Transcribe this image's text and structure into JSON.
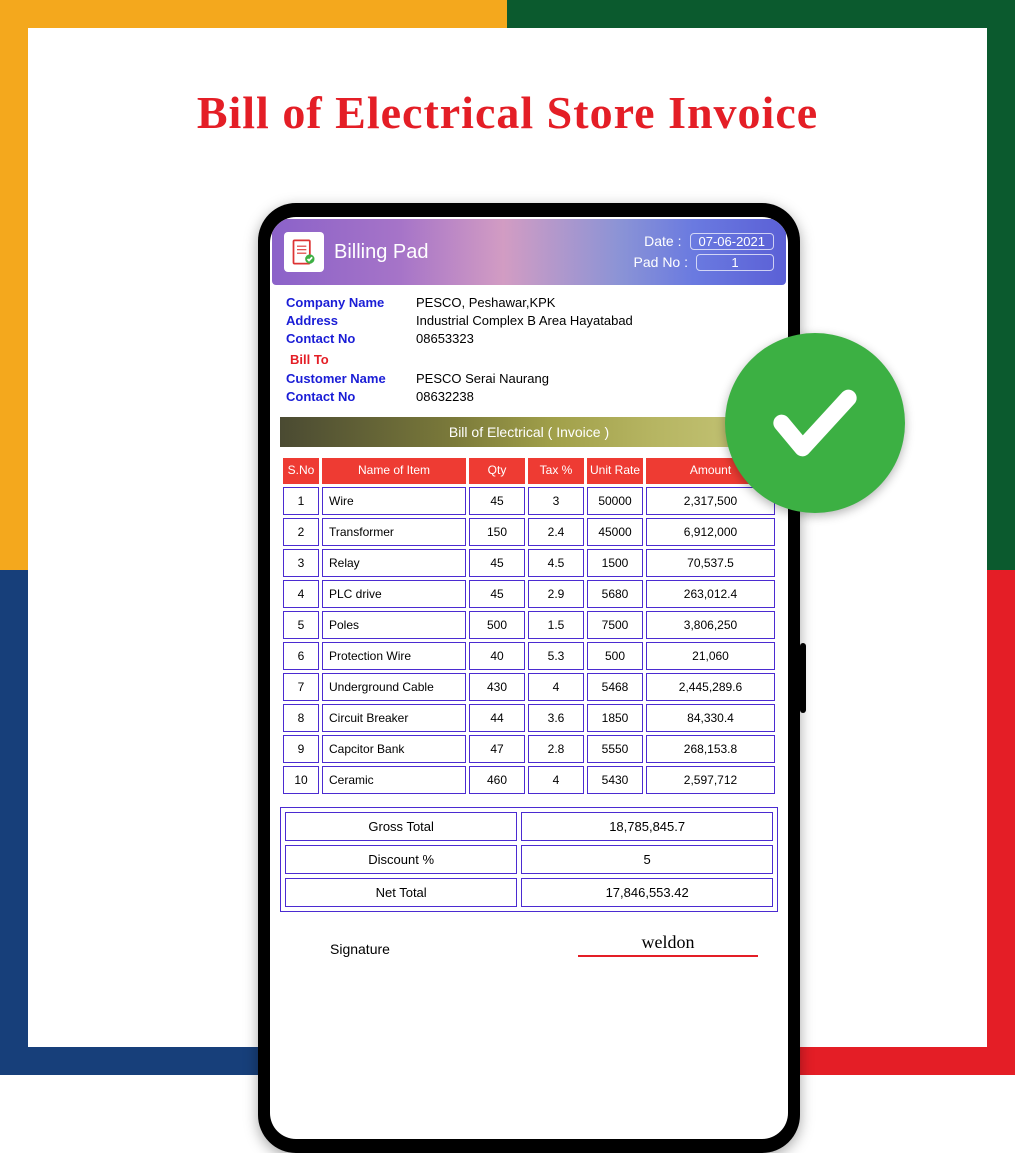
{
  "heading": "Bill of Electrical Store Invoice",
  "header": {
    "title": "Billing Pad",
    "date_label": "Date :",
    "date_value": "07-06-2021",
    "pad_label": "Pad No :",
    "pad_value": "1"
  },
  "company": {
    "name_label": "Company Name",
    "name_value": "PESCO, Peshawar,KPK",
    "address_label": "Address",
    "address_value": "Industrial Complex B Area Hayatabad",
    "contact_label": "Contact No",
    "contact_value": "08653323"
  },
  "bill_to_label": "Bill To",
  "customer": {
    "name_label": "Customer Name",
    "name_value": "PESCO Serai Naurang",
    "contact_label": "Contact No",
    "contact_value": "08632238"
  },
  "section_title": "Bill of Electrical ( Invoice )",
  "columns": {
    "sno": "S.No",
    "name": "Name of Item",
    "qty": "Qty",
    "tax": "Tax %",
    "rate": "Unit Rate",
    "amount": "Amount"
  },
  "rows": [
    {
      "sno": "1",
      "name": "Wire",
      "qty": "45",
      "tax": "3",
      "rate": "50000",
      "amount": "2,317,500"
    },
    {
      "sno": "2",
      "name": "Transformer",
      "qty": "150",
      "tax": "2.4",
      "rate": "45000",
      "amount": "6,912,000"
    },
    {
      "sno": "3",
      "name": "Relay",
      "qty": "45",
      "tax": "4.5",
      "rate": "1500",
      "amount": "70,537.5"
    },
    {
      "sno": "4",
      "name": "PLC drive",
      "qty": "45",
      "tax": "2.9",
      "rate": "5680",
      "amount": "263,012.4"
    },
    {
      "sno": "5",
      "name": "Poles",
      "qty": "500",
      "tax": "1.5",
      "rate": "7500",
      "amount": "3,806,250"
    },
    {
      "sno": "6",
      "name": "Protection Wire",
      "qty": "40",
      "tax": "5.3",
      "rate": "500",
      "amount": "21,060"
    },
    {
      "sno": "7",
      "name": "Underground Cable",
      "qty": "430",
      "tax": "4",
      "rate": "5468",
      "amount": "2,445,289.6"
    },
    {
      "sno": "8",
      "name": "Circuit Breaker",
      "qty": "44",
      "tax": "3.6",
      "rate": "1850",
      "amount": "84,330.4"
    },
    {
      "sno": "9",
      "name": "Capcitor Bank",
      "qty": "47",
      "tax": "2.8",
      "rate": "5550",
      "amount": "268,153.8"
    },
    {
      "sno": "10",
      "name": "Ceramic",
      "qty": "460",
      "tax": "4",
      "rate": "5430",
      "amount": "2,597,712"
    }
  ],
  "totals": {
    "gross_label": "Gross Total",
    "gross_value": "18,785,845.7",
    "discount_label": "Discount %",
    "discount_value": "5",
    "net_label": "Net Total",
    "net_value": "17,846,553.42"
  },
  "signature": {
    "label": "Signature",
    "value": "weldon"
  }
}
